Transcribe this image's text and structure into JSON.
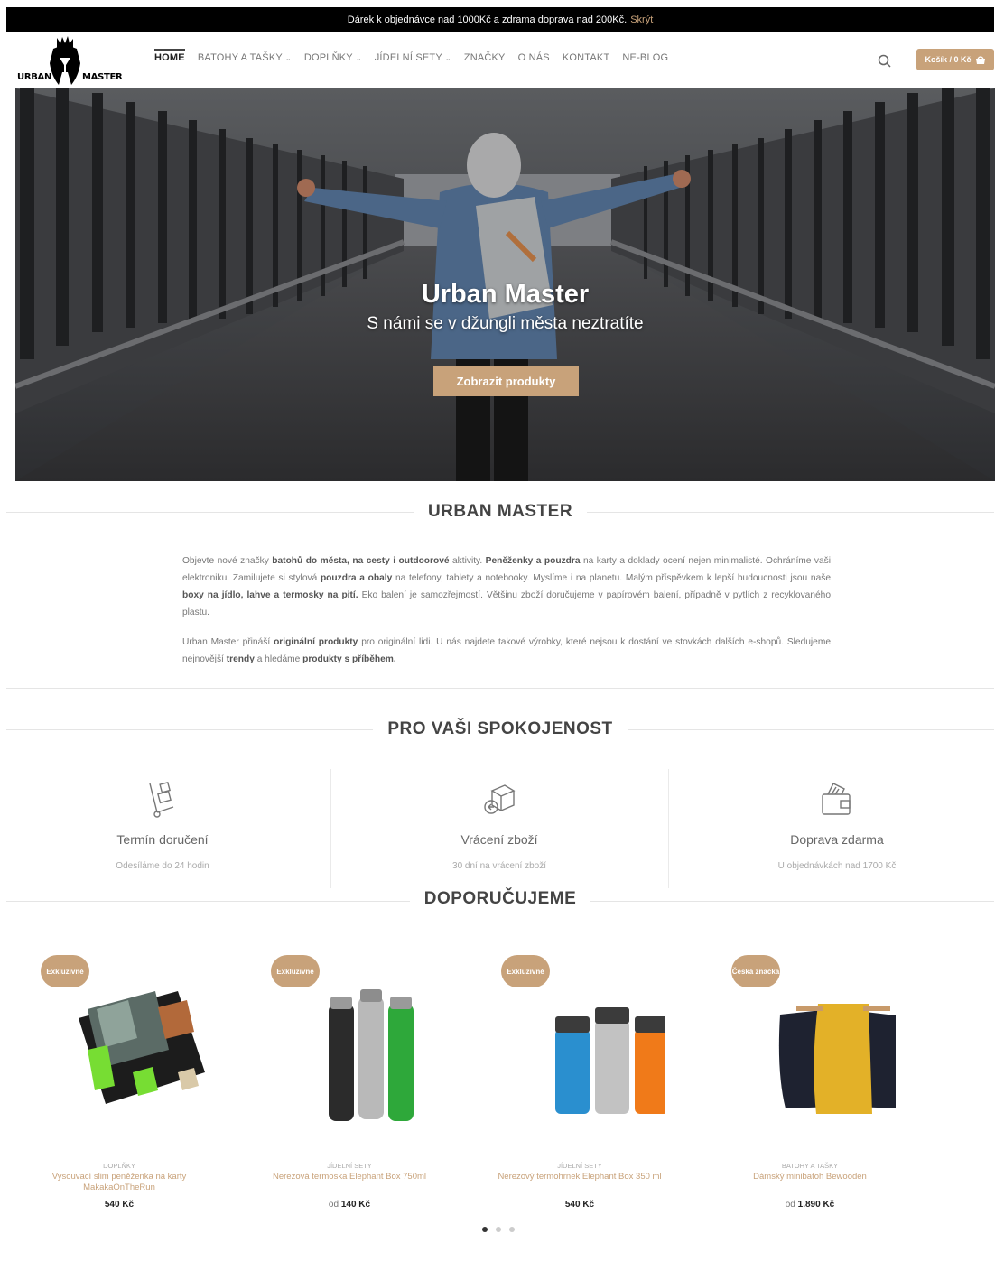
{
  "topbar": {
    "message": "Dárek k objednávce nad 1000Kč a zdrama doprava nad 200Kč.",
    "hide_label": "Skrýt"
  },
  "logo": {
    "left_text": "URBAN",
    "right_text": "MASTER"
  },
  "nav": {
    "items": [
      {
        "label": "HOME",
        "active": true,
        "dropdown": false
      },
      {
        "label": "BATOHY A TAŠKY",
        "active": false,
        "dropdown": true
      },
      {
        "label": "DOPLŇKY",
        "active": false,
        "dropdown": true
      },
      {
        "label": "JÍDELNÍ SETY",
        "active": false,
        "dropdown": true
      },
      {
        "label": "ZNAČKY",
        "active": false,
        "dropdown": false
      },
      {
        "label": "O NÁS",
        "active": false,
        "dropdown": false
      },
      {
        "label": "KONTAKT",
        "active": false,
        "dropdown": false
      },
      {
        "label": "NE-BLOG",
        "active": false,
        "dropdown": false
      }
    ],
    "cart_label": "Košík / 0 Kč"
  },
  "hero": {
    "title": "Urban Master",
    "subtitle": "S námi se v džungli města neztratíte",
    "cta": "Zobrazit produkty"
  },
  "about": {
    "heading": "URBAN MASTER",
    "p1_parts": [
      {
        "t": "Objevte nové značky ",
        "b": false
      },
      {
        "t": "batohů do města, na cesty i outdoorové",
        "b": true
      },
      {
        "t": " aktivity. ",
        "b": false
      },
      {
        "t": "Peněženky a pouzdra",
        "b": true
      },
      {
        "t": " na karty a doklady ocení nejen minimalisté. Ochráníme vaši elektroniku. Zamilujete si stylová ",
        "b": false
      },
      {
        "t": "pouzdra a obaly",
        "b": true
      },
      {
        "t": " na telefony, tablety a notebooky. Myslíme i na planetu. Malým příspěvkem k lepší budoucnosti jsou naše ",
        "b": false
      },
      {
        "t": "boxy na jídlo, lahve a termosky na pití.",
        "b": true
      },
      {
        "t": " Eko balení je samozřejmostí. Většinu zboží doručujeme v papírovém balení, případně v pytlích z recyklovaného plastu.",
        "b": false
      }
    ],
    "p2_parts": [
      {
        "t": "Urban Master přináší ",
        "b": false
      },
      {
        "t": "originální produkty",
        "b": true
      },
      {
        "t": " pro originální lidi. U nás najdete takové výrobky, které nejsou k dostání ve stovkách dalších e-shopů. Sledujeme nejnovější ",
        "b": false
      },
      {
        "t": "trendy",
        "b": true
      },
      {
        "t": " a hledáme ",
        "b": false
      },
      {
        "t": "produkty s příběhem.",
        "b": true
      }
    ]
  },
  "features": {
    "heading": "PRO VAŠI SPOKOJENOST",
    "items": [
      {
        "title": "Termín doručení",
        "subtitle": "Odesíláme do 24 hodin",
        "icon": "hand-truck-icon"
      },
      {
        "title": "Vrácení zboží",
        "subtitle": "30 dní na vrácení zboží",
        "icon": "return-box-icon"
      },
      {
        "title": "Doprava zdarma",
        "subtitle": "U objednávkách nad 1700 Kč",
        "icon": "wallet-icon"
      }
    ]
  },
  "products": {
    "heading": "DOPORUČUJEME",
    "items": [
      {
        "badge": "Exkluzivně",
        "category": "DOPLŇKY",
        "name": "Vysouvací slim peněženka na karty MakakaOnTheRun",
        "price_prefix": "",
        "price": "540 Kč"
      },
      {
        "badge": "Exkluzivně",
        "category": "JÍDELNÍ SETY",
        "name": "Nerezová termoska Elephant Box 750ml",
        "price_prefix": "od",
        "price": "140 Kč"
      },
      {
        "badge": "Exkluzivně",
        "category": "JÍDELNÍ SETY",
        "name": "Nerezový termohrnek Elephant Box 350 ml",
        "price_prefix": "",
        "price": "540 Kč"
      },
      {
        "badge": "Česká značka",
        "category": "BATOHY A TAŠKY",
        "name": "Dámský minibatoh Bewooden",
        "price_prefix": "od",
        "price": "1.890 Kč"
      }
    ]
  },
  "colors": {
    "accent": "#c8a27a",
    "topbar": "#000000"
  }
}
